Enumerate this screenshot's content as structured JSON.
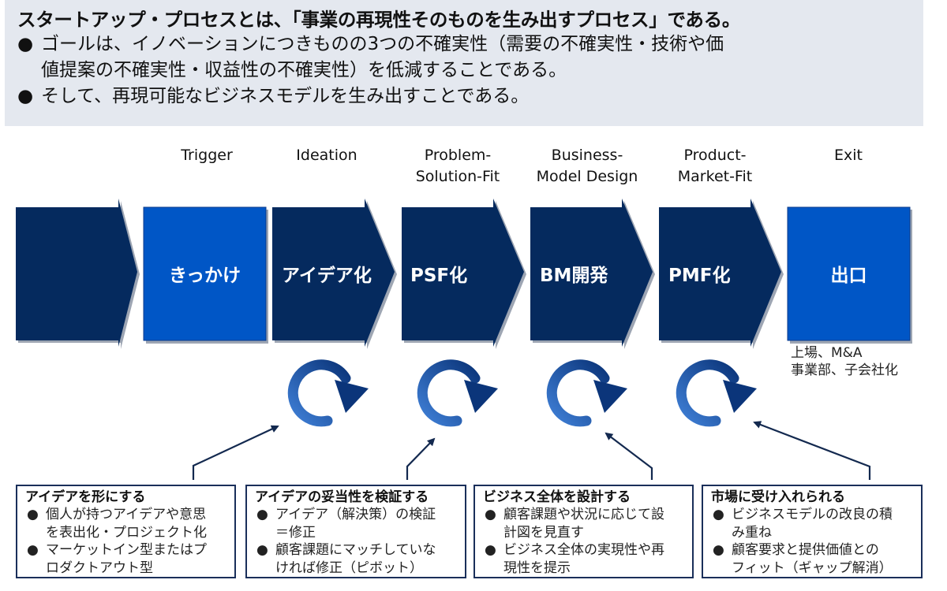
{
  "header": {
    "title": "スタートアップ・プロセスとは、「事業の再現性そのものを生み出すプロセス」である。",
    "bullets": [
      {
        "line1": "ゴールは、イノベーションにつきものの3つの不確実性（需要の不確実性・技術や価",
        "line2": "値提案の不確実性・収益性の不確実性）を低減することである。"
      },
      {
        "line1": "そして、再現可能なビジネスモデルを生み出すことである。"
      }
    ],
    "bullet_glyph": "●"
  },
  "stages": [
    {
      "label_line1": "",
      "label_line2": "",
      "shape_text": "",
      "type": "arrow"
    },
    {
      "label_line1": "Trigger",
      "label_line2": "",
      "shape_text": "きっかけ",
      "type": "box"
    },
    {
      "label_line1": "Ideation",
      "label_line2": "",
      "shape_text": "アイデア化",
      "type": "arrow"
    },
    {
      "label_line1": "Problem-",
      "label_line2": "Solution-Fit",
      "shape_text": "PSF化",
      "type": "arrow"
    },
    {
      "label_line1": "Business-",
      "label_line2": "Model Design",
      "shape_text": "BM開発",
      "type": "arrow"
    },
    {
      "label_line1": "Product-",
      "label_line2": "Market-Fit",
      "shape_text": "PMF化",
      "type": "arrow"
    },
    {
      "label_line1": "Exit",
      "label_line2": "",
      "shape_text": "出口",
      "type": "box"
    }
  ],
  "exit_note": {
    "line1": "上場、M&A",
    "line2": "事業部、子会社化"
  },
  "colors": {
    "arrow_navy": "#052a5e",
    "box_blue": "#0056c6",
    "cycle_light": "#3a78d0",
    "cycle_dark": "#0c3a80",
    "border": "#1a2f5a"
  },
  "cycle_icons": [
    "ideation-cycle",
    "psf-cycle",
    "bm-cycle",
    "pmf-cycle"
  ],
  "boxes": [
    {
      "title": "アイデアを形にする",
      "items": [
        {
          "line1": "個人が持つアイデアや意思",
          "line2": "を表出化・プロジェクト化"
        },
        {
          "line1": "マーケットイン型またはプ",
          "line2": "ロダクトアウト型"
        }
      ]
    },
    {
      "title": "アイデアの妥当性を検証する",
      "items": [
        {
          "line1": "アイデア（解決策）の検証",
          "line2": "＝修正"
        },
        {
          "line1": "顧客課題にマッチしていな",
          "line2": "ければ修正（ピボット）"
        }
      ]
    },
    {
      "title": "ビジネス全体を設計する",
      "items": [
        {
          "line1": "顧客課題や状況に応じて設",
          "line2": "計図を見直す"
        },
        {
          "line1": "ビジネス全体の実現性や再",
          "line2": "現性を提示"
        }
      ]
    },
    {
      "title": "市場に受け入れられる",
      "items": [
        {
          "line1": "ビジネスモデルの改良の積",
          "line2": "み重ね"
        },
        {
          "line1": "顧客要求と提供価値との",
          "line2": "フィット（ギャップ解消）"
        }
      ]
    }
  ]
}
